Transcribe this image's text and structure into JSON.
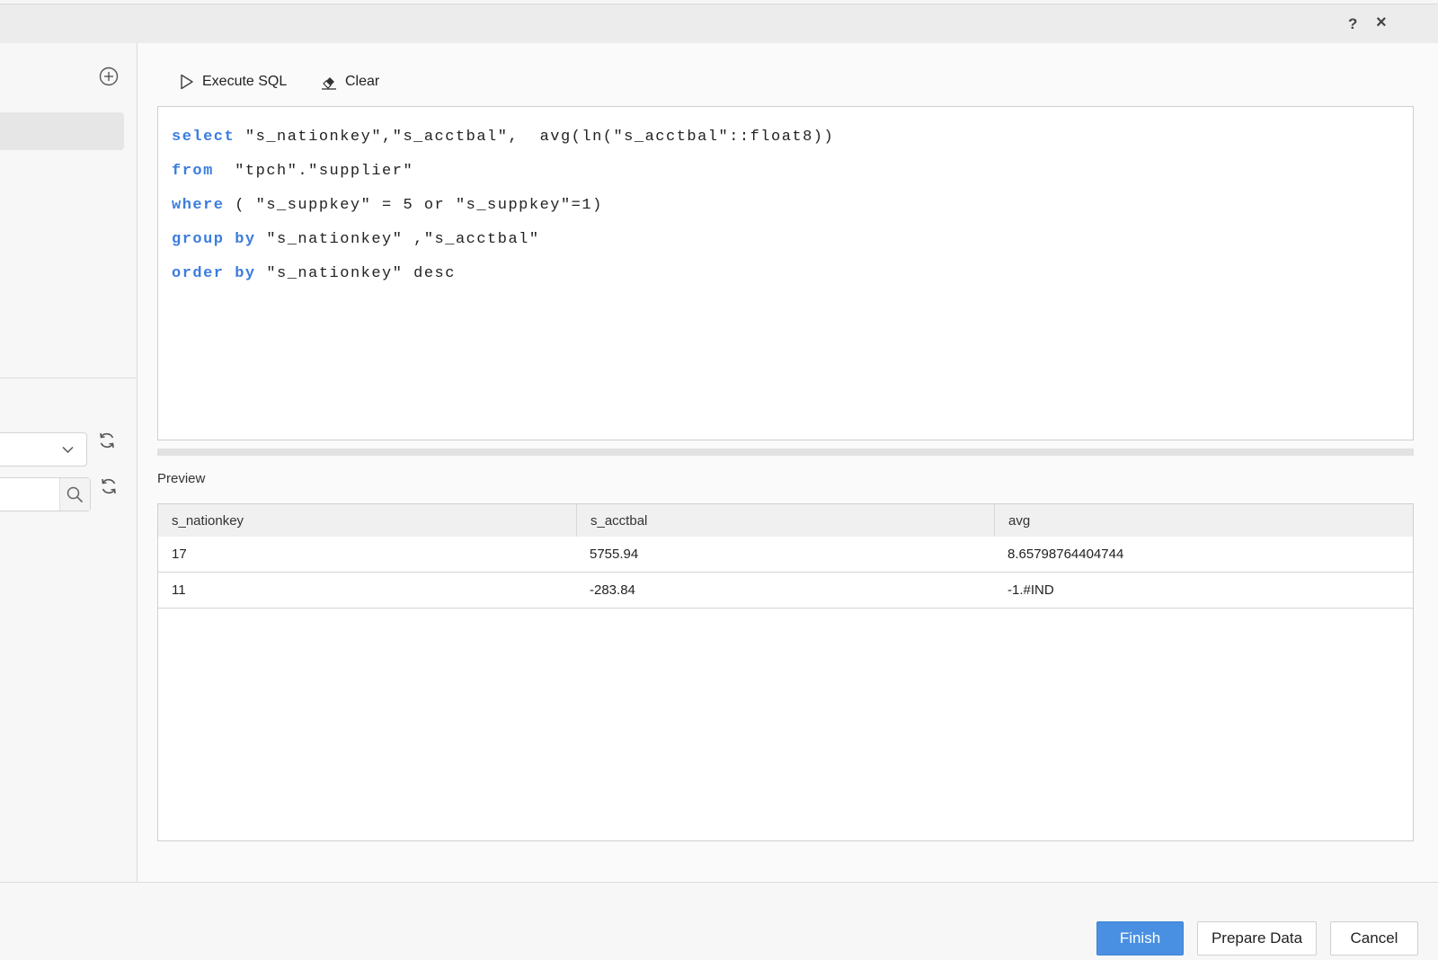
{
  "window": {
    "help_label": "?",
    "close_label": "×"
  },
  "toolbar": {
    "execute_label": "Execute SQL",
    "clear_label": "Clear"
  },
  "editor": {
    "lines": [
      {
        "kw": "select",
        "rest": " \"s_nationkey\",\"s_acctbal\",  avg(ln(\"s_acctbal\"::float8))"
      },
      {
        "kw": "from",
        "rest": "  \"tpch\".\"supplier\""
      },
      {
        "kw": "where",
        "rest": " ( \"s_suppkey\" = 5 or \"s_suppkey\"=1)"
      },
      {
        "kw": "group by",
        "rest": " \"s_nationkey\" ,\"s_acctbal\""
      },
      {
        "kw": "order by",
        "rest": " \"s_nationkey\" desc"
      }
    ],
    "keyword_color": "#3b7ddd"
  },
  "preview": {
    "label": "Preview",
    "columns": [
      "s_nationkey",
      "s_acctbal",
      "avg"
    ],
    "rows": [
      [
        "17",
        "5755.94",
        "8.65798764404744"
      ],
      [
        "11",
        "-283.84",
        "-1.#IND"
      ]
    ]
  },
  "left_panel": {
    "select_value": "",
    "search_value": ""
  },
  "footer": {
    "finish_label": "Finish",
    "prepare_label": "Prepare Data",
    "cancel_label": "Cancel",
    "primary_color": "#4a90e2"
  },
  "icons": {
    "add": "plus-circle-icon",
    "execute": "play-icon",
    "clear": "eraser-icon",
    "dropdown": "chevron-down-icon",
    "search": "search-icon",
    "refresh": "refresh-icon"
  }
}
